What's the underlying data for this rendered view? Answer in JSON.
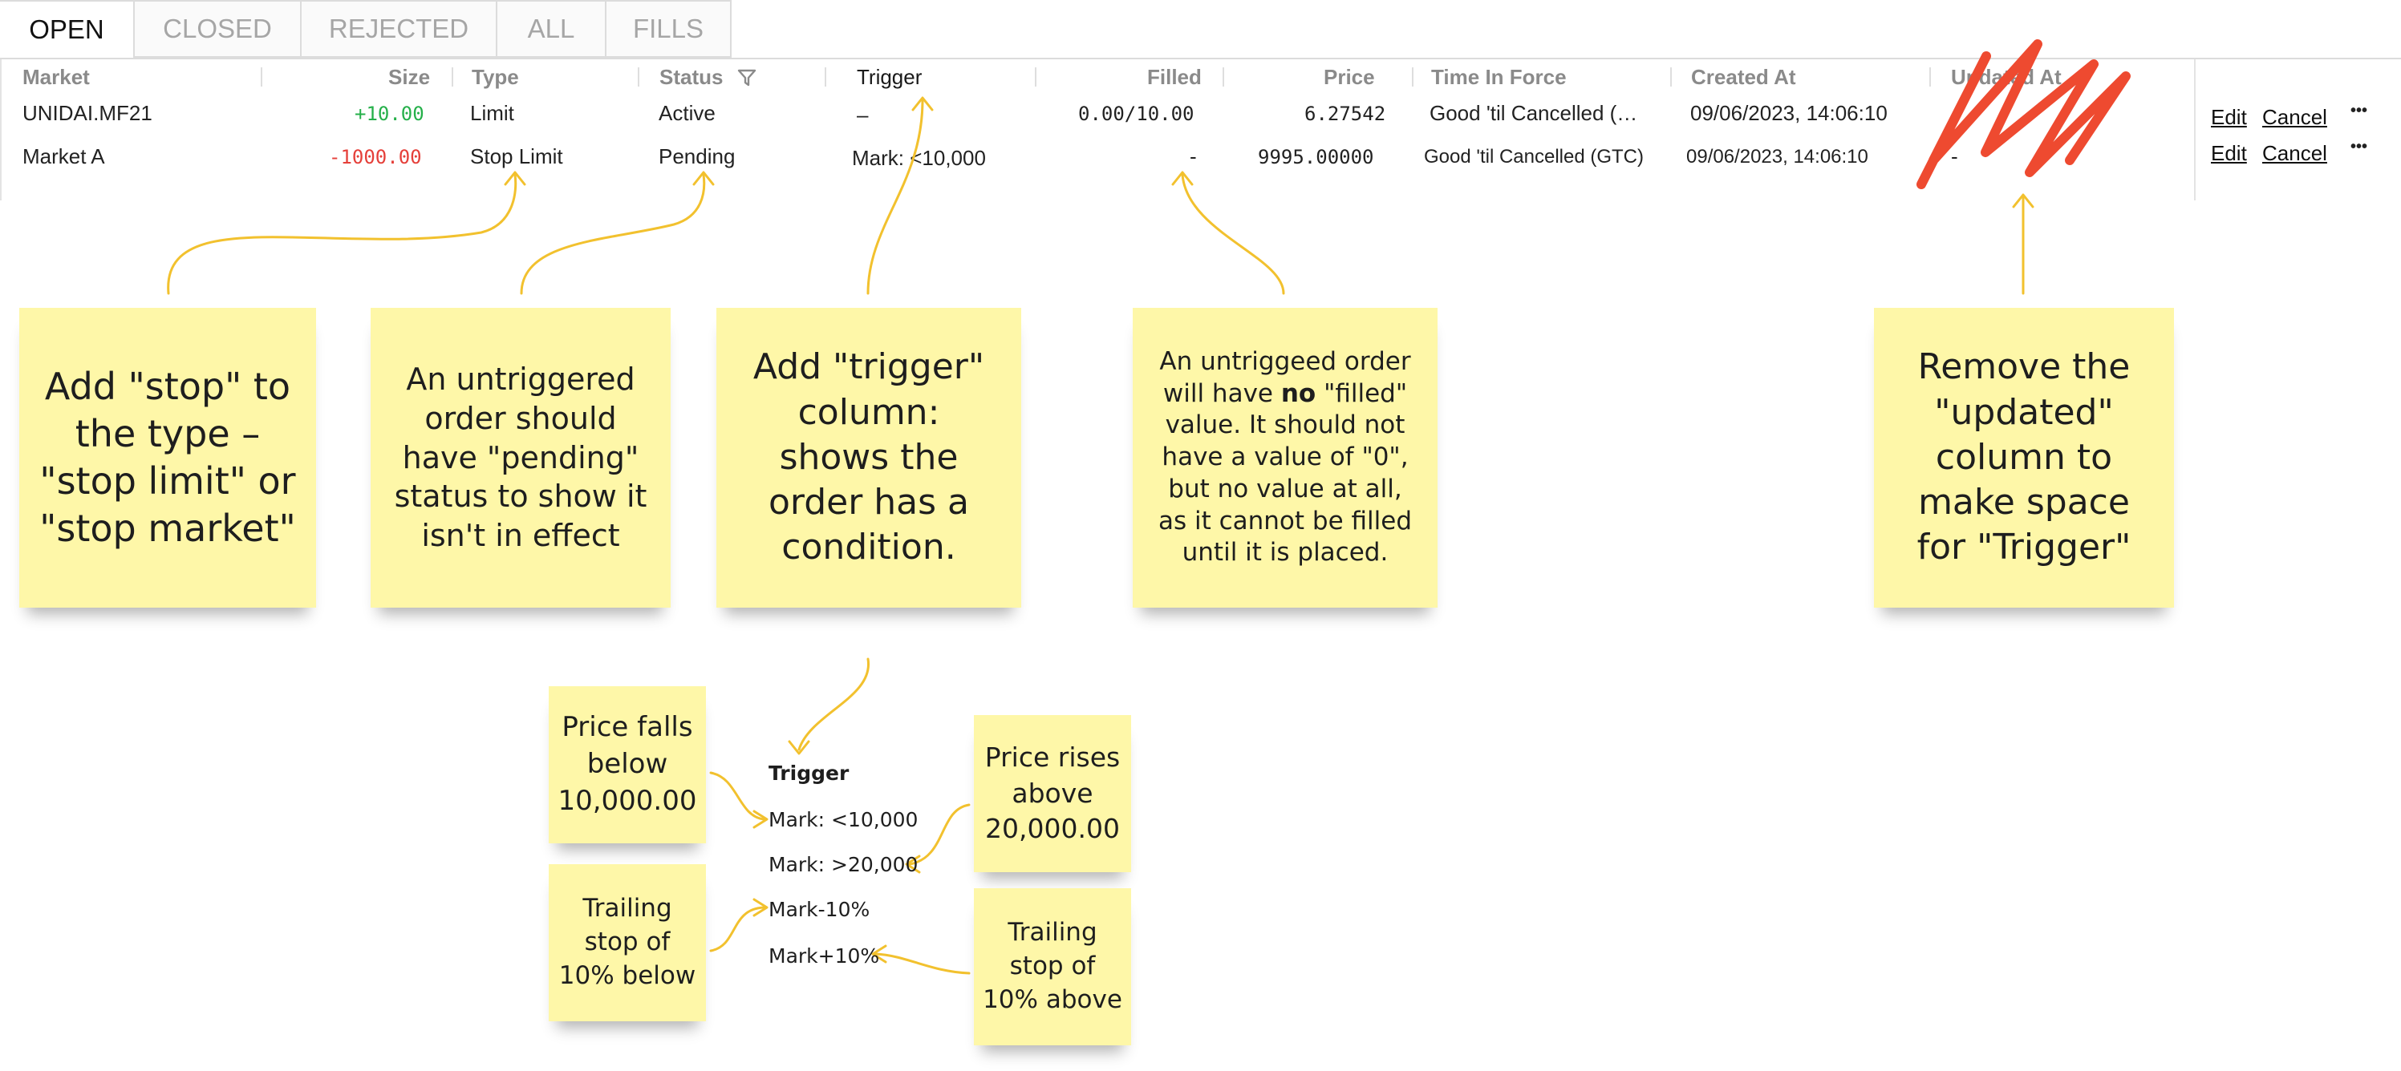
{
  "tabs": [
    {
      "label": "OPEN",
      "active": true
    },
    {
      "label": "CLOSED",
      "active": false
    },
    {
      "label": "REJECTED",
      "active": false
    },
    {
      "label": "ALL",
      "active": false
    },
    {
      "label": "FILLS",
      "active": false
    }
  ],
  "table": {
    "headers": {
      "market": "Market",
      "size": "Size",
      "type": "Type",
      "status": "Status",
      "trigger": "Trigger",
      "filled": "Filled",
      "price": "Price",
      "time_in_force": "Time In Force",
      "created_at": "Created At",
      "updated_at": "Updated At"
    },
    "rows": [
      {
        "market": "UNIDAI.MF21",
        "size": "+10.00",
        "type": "Limit",
        "status": "Active",
        "trigger": "–",
        "filled": "0.00/10.00",
        "price": "6.27542",
        "time_in_force": "Good 'til Cancelled (…",
        "created_at": "09/06/2023, 14:06:10",
        "updated_at": "-",
        "edit": "Edit",
        "cancel": "Cancel",
        "more": "•••"
      },
      {
        "market": "Market A",
        "size": "-1000.00",
        "type": "Stop Limit",
        "status": "Pending",
        "trigger": "Mark: <10,000",
        "filled": "-",
        "price": "9995.00000",
        "time_in_force": "Good 'til Cancelled (GTC)",
        "created_at": "09/06/2023, 14:06:10",
        "updated_at": "-",
        "edit": "Edit",
        "cancel": "Cancel",
        "more": "•••"
      }
    ]
  },
  "notes": {
    "stop_type": [
      "Add \"stop\" to",
      "the type –",
      "\"stop limit\" or",
      "\"stop market\""
    ],
    "pending": [
      "An untriggered",
      "order should",
      "have \"pending\"",
      "status to show it",
      "isn't in effect"
    ],
    "trigger_col": [
      "Add \"trigger\"",
      "column:",
      "shows the",
      "order has a",
      "condition."
    ],
    "filled": {
      "line1": "An untriggeed order",
      "line2_pre": "will have ",
      "line2_bold": "no",
      "line2_post": " \"filled\"",
      "line3": "value. It should not",
      "line4": "have a value of \"0\",",
      "line5": "but no value at all,",
      "line6": "as it cannot be filled",
      "line7": "until it is placed."
    },
    "remove_updated": [
      "Remove the",
      "\"updated\"",
      "column to",
      "make space",
      "for \"Trigger\""
    ],
    "price_falls": [
      "Price falls",
      "below",
      "10,000.00"
    ],
    "price_rises": [
      "Price rises",
      "above",
      "20,000.00"
    ],
    "trailing_below": [
      "Trailing",
      "stop of",
      "10% below"
    ],
    "trailing_above": [
      "Trailing",
      "stop of",
      "10% above"
    ]
  },
  "trigger_examples": {
    "heading": "Trigger",
    "items": [
      "Mark: <10,000",
      "Mark: >20,000",
      "Mark-10%",
      "Mark+10%"
    ]
  },
  "colors": {
    "note": "#fef7a8",
    "arrow": "#f2c12e",
    "scribble": "#ee4a30",
    "positive": "#25b04a",
    "negative": "#e5403a"
  }
}
